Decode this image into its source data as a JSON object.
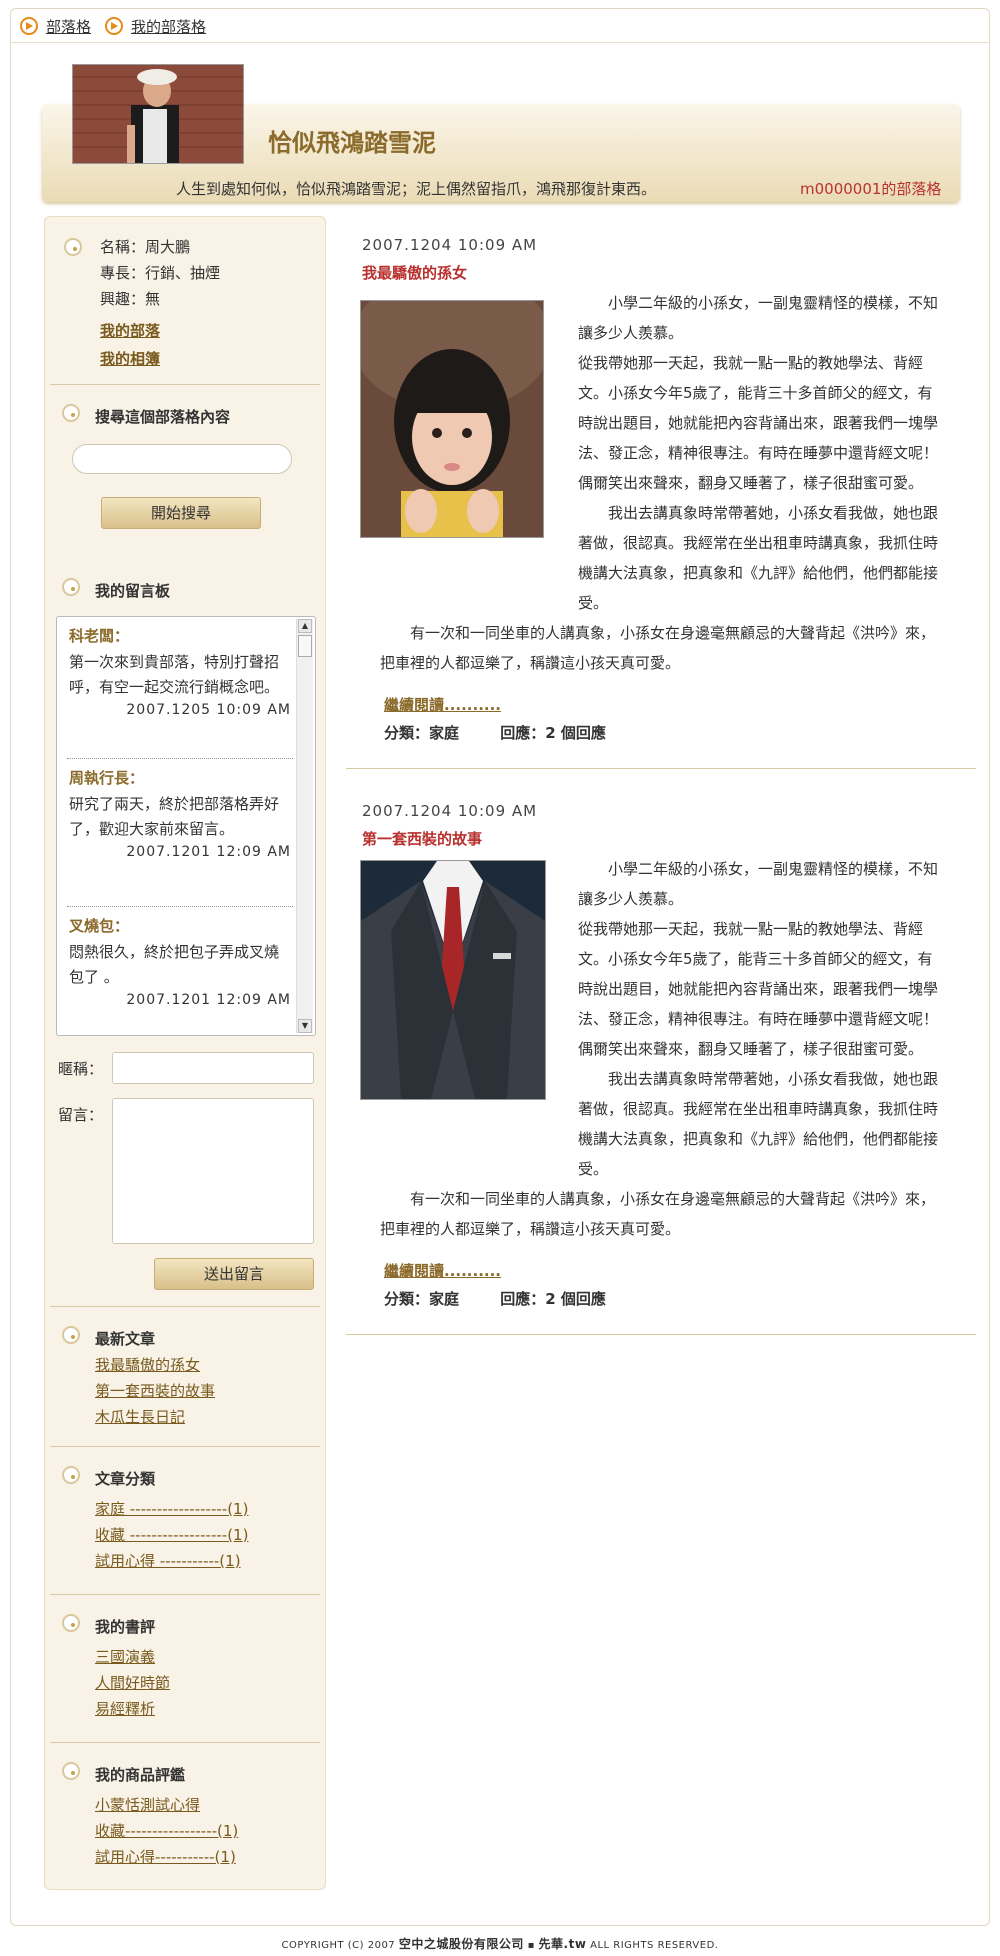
{
  "nav": {
    "items": [
      "部落格",
      "我的部落格"
    ]
  },
  "banner": {
    "title": "恰似飛鴻踏雪泥",
    "motto": "人生到處知何似，恰似飛鴻踏雪泥；泥上偶然留指爪，鴻飛那復計東西。",
    "owner": "m0000001的部落格"
  },
  "profile": {
    "name": "名稱：周大鵬",
    "skill": "專長：行銷、抽煙",
    "hobby": "興趣：無",
    "link_tribe": "我的部落",
    "link_album": "我的相簿"
  },
  "search": {
    "title": "搜尋這個部落格內容",
    "button": "開始搜尋",
    "value": ""
  },
  "guestbook": {
    "title": "我的留言板",
    "messages": [
      {
        "name": "科老闆：",
        "text": "第一次來到貴部落，特別打聲招呼，有空一起交流行銷概念吧。",
        "time": "2007.1205 10:09 AM"
      },
      {
        "name": "周執行長：",
        "text": "研究了兩天，終於把部落格弄好了，歡迎大家前來留言。",
        "time": "2007.1201 12:09 AM"
      },
      {
        "name": "叉燒包：",
        "text": "悶熱很久，終於把包子弄成叉燒包了 。",
        "time": "2007.1201 12:09 AM"
      }
    ],
    "nickname_label": "暱稱：",
    "message_label": "留言：",
    "submit": "送出留言"
  },
  "latest": {
    "title": "最新文章",
    "items": [
      "我最驕傲的孫女",
      "第一套西裝的故事",
      "木瓜生長日記"
    ]
  },
  "categories": {
    "title": "文章分類",
    "items": [
      "家庭 ------------------(1)",
      "收藏 ------------------(1)",
      "試用心得 -----------(1)"
    ]
  },
  "book_reviews": {
    "title": "我的書評",
    "items": [
      "三國演義",
      "人間好時節",
      "易經釋析"
    ]
  },
  "product_reviews": {
    "title": "我的商品評鑑",
    "items": [
      {
        "label": "小蒙恬測試心得",
        "count": ""
      },
      {
        "label": "收藏-----------------",
        "count": "(1)"
      },
      {
        "label": "試用心得-----------",
        "count": "(1)"
      }
    ]
  },
  "posts": [
    {
      "date": "2007.1204 10:09 AM",
      "title": "我最驕傲的孫女",
      "image": "girl-photo",
      "para1": "小學二年級的小孫女，一副鬼靈精怪的模樣，不知讓多少人羨慕。",
      "para2": "從我帶她那一天起，我就一點一點的教她學法、背經文。小孫女今年5歲了，能背三十多首師父的經文，有時說出題目，她就能把內容背誦出來，跟著我們一塊學法、發正念，精神很專注。有時在睡夢中還背經文呢！偶爾笑出來聲來，翻身又睡著了，樣子很甜蜜可愛。",
      "para3": "我出去講真象時常帶著她，小孫女看我做，她也跟著做，很認真。我經常在坐出租車時講真象，我抓住時機講大法真象，把真象和《九評》給他們，他們都能接受。",
      "para4": "有一次和一同坐車的人講真象，小孫女在身邊毫無顧忌的大聲背起《洪吟》來，把車裡的人都逗樂了，稱讚這小孩天真可愛。",
      "more": "繼續閱讀..........",
      "category": "分類：家庭",
      "replies": "回應：2 個回應"
    },
    {
      "date": "2007.1204 10:09 AM",
      "title": "第一套西裝的故事",
      "image": "suit-photo",
      "para1": "小學二年級的小孫女，一副鬼靈精怪的模樣，不知讓多少人羨慕。",
      "para2": "從我帶她那一天起，我就一點一點的教她學法、背經文。小孫女今年5歲了，能背三十多首師父的經文，有時說出題目，她就能把內容背誦出來，跟著我們一塊學法、發正念，精神很專注。有時在睡夢中還背經文呢！偶爾笑出來聲來，翻身又睡著了，樣子很甜蜜可愛。",
      "para3": "我出去講真象時常帶著她，小孫女看我做，她也跟著做，很認真。我經常在坐出租車時講真象，我抓住時機講大法真象，把真象和《九評》給他們，他們都能接受。",
      "para4": "有一次和一同坐車的人講真象，小孫女在身邊毫無顧忌的大聲背起《洪吟》來，把車裡的人都逗樂了，稱讚這小孩天真可愛。",
      "more": "繼續閱讀..........",
      "category": "分類：家庭",
      "replies": "回應：2 個回應"
    }
  ],
  "footer": {
    "prefix": "COPYRIGHT (C) 2007",
    "company": "空中之城股份有限公司",
    "brand": "先華.tw",
    "suffix": "ALL RIGHTS RESERVED."
  }
}
